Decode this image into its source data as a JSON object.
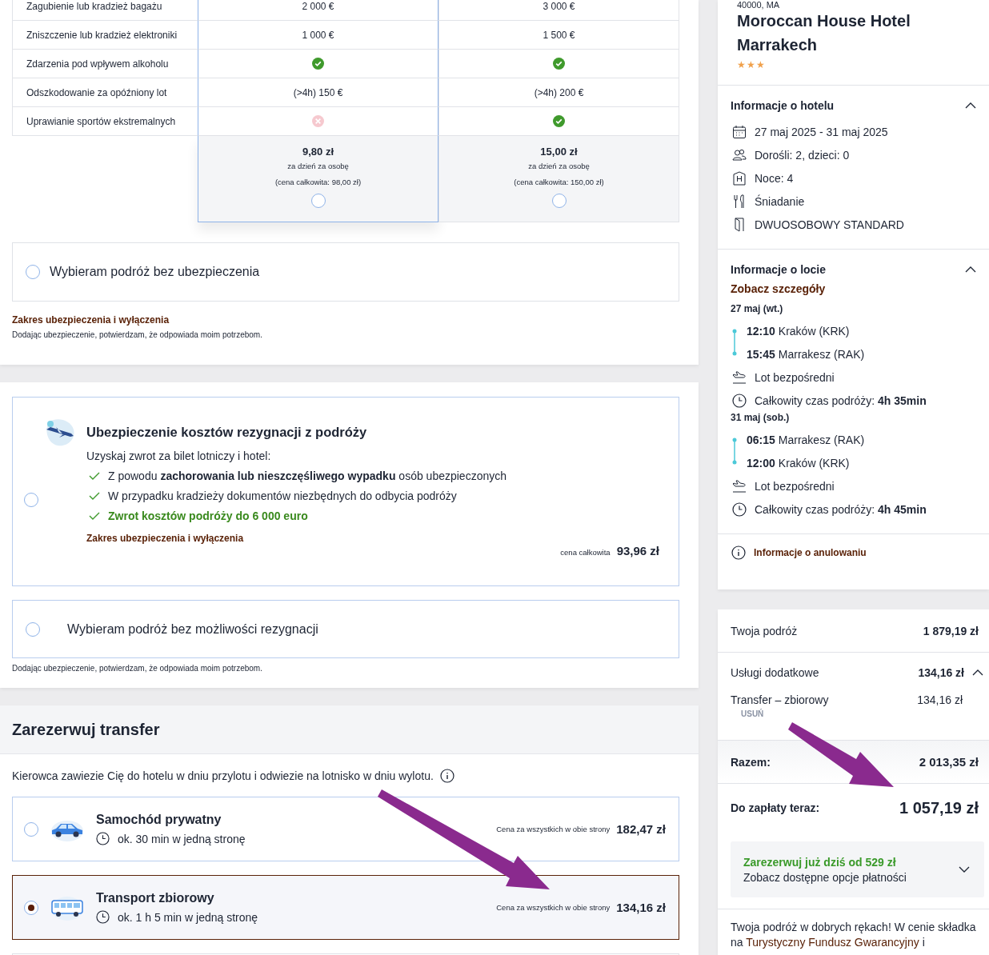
{
  "insurance_table": {
    "rows": [
      {
        "label": "Zagubienie lub kradzież bagażu",
        "cells": [
          {
            "kind": "text",
            "text": "2 000 €"
          },
          {
            "kind": "text",
            "text": "3 000 €"
          }
        ]
      },
      {
        "label": "Zniszczenie lub kradzież elektroniki",
        "cells": [
          {
            "kind": "text",
            "text": "1 000 €"
          },
          {
            "kind": "text",
            "text": "1 500 €"
          }
        ]
      },
      {
        "label": "Zdarzenia pod wpływem alkoholu",
        "cells": [
          {
            "kind": "check"
          },
          {
            "kind": "check"
          }
        ]
      },
      {
        "label": "Odszkodowanie za opóźniony lot",
        "cells": [
          {
            "kind": "text",
            "text": "(>4h) 150 €"
          },
          {
            "kind": "text",
            "text": "(>4h) 200 €"
          }
        ]
      },
      {
        "label": "Uprawianie sportów ekstremalnych",
        "cells": [
          {
            "kind": "cross"
          },
          {
            "kind": "check"
          }
        ]
      }
    ],
    "plans": [
      {
        "price": "9,80 zł",
        "per": "za dzień za osobę",
        "total": "(cena całkowita: 98,00 zł)",
        "highlighted": true,
        "selected": false
      },
      {
        "price": "15,00 zł",
        "per": "za dzień za osobę",
        "total": "(cena całkowita: 150,00 zł)",
        "highlighted": false,
        "selected": false
      }
    ]
  },
  "no_insurance_option": {
    "label": "Wybieram podróż bez ubezpieczenia",
    "selected": false
  },
  "terms_link": "Zakres ubezpieczenia i wyłączenia",
  "consent_note": "Dodając ubezpieczenie, potwierdzam, że odpowiada moim potrzebom.",
  "cancellation": {
    "options": [
      {
        "kind": "offer",
        "title": "Ubezpieczenie kosztów rezygnacji z podróży",
        "intro": "Uzyskaj zwrot za bilet lotniczy i hotel:",
        "features": [
          {
            "text": "Z powodu **zachorowania lub nieszczęśliwego wypadku** osób ubezpieczonych",
            "highlight": false
          },
          {
            "text": "W przypadku kradzieży dokumentów niezbędnych do odbycia podróży",
            "highlight": false
          },
          {
            "text": "Zwrot kosztów podróży do 6 000 euro",
            "highlight": true
          }
        ],
        "link": "Zakres ubezpieczenia i wyłączenia",
        "price_label": "cena całkowita",
        "price": "93,96 zł",
        "selected": false
      },
      {
        "kind": "simple",
        "label": "Wybieram podróż bez możliwości rezygnacji",
        "selected": false
      }
    ],
    "note": "Dodając ubezpieczenie, potwierdzam, że odpowiada moim potrzebom."
  },
  "transfer": {
    "title": "Zarezerwuj transfer",
    "description": "Kierowca zawiezie Cię do hotelu w dniu przylotu i odwiezie na lotnisko w dniu wylotu.",
    "options": [
      {
        "kind": "car",
        "name": "Samochód prywatny",
        "duration": "ok. 30 min w jedną stronę",
        "price_label": "Cena za wszystkich w obie strony",
        "price": "182,47 zł",
        "selected": false
      },
      {
        "kind": "bus",
        "name": "Transport zbiorowy",
        "duration": "ok. 1 h 5 min w jedną stronę",
        "price_label": "Cena za wszystkich w obie strony",
        "price": "134,16 zł",
        "selected": true
      }
    ]
  },
  "hotel": {
    "address": "40000, MA",
    "name": "Moroccan House Hotel Marrakech",
    "stars": 3
  },
  "hotel_info": {
    "title": "Informacje o hotelu",
    "expanded": true,
    "items": [
      {
        "kind": "calendar",
        "text": "27 maj 2025 - 31 maj 2025"
      },
      {
        "kind": "people",
        "text": "Dorośli: 2, dzieci: 0"
      },
      {
        "kind": "hotel",
        "text": "Noce: 4"
      },
      {
        "kind": "meal",
        "text": "Śniadanie"
      },
      {
        "kind": "room",
        "text": "DWUOSOBOWY STANDARD"
      }
    ]
  },
  "flight_info": {
    "title": "Informacje o locie",
    "expanded": true,
    "details_link": "Zobacz szczegóły",
    "legs": [
      {
        "date": "27 maj (wt.)",
        "departure_time": "12:10",
        "departure_place": "Kraków (KRK)",
        "arrival_time": "15:45",
        "arrival_place": "Marrakesz (RAK)",
        "type": "Lot bezpośredni",
        "duration_label": "Całkowity czas podróży:",
        "duration": "4h 35min"
      },
      {
        "date": "31 maj (sob.)",
        "departure_time": "06:15",
        "departure_place": "Marrakesz (RAK)",
        "arrival_time": "12:00",
        "arrival_place": "Kraków (KRK)",
        "type": "Lot bezpośredni",
        "duration_label": "Całkowity czas podróży:",
        "duration": "4h 45min"
      }
    ]
  },
  "cancellation_info_link": "Informacje o anulowaniu",
  "summary": {
    "trip_label": "Twoja podróż",
    "trip_value": "1 879,19 zł",
    "extras_label": "Usługi dodatkowe",
    "extras_value": "134,16 zł",
    "extras_expanded": true,
    "extras": [
      {
        "label": "Transfer – zbiorowy",
        "value": "134,16 zł",
        "remove": "USUŃ"
      }
    ],
    "total_label": "Razem:",
    "total_value": "2 013,35 zł",
    "pay_now_label": "Do zapłaty teraz:",
    "pay_now_value": "1 057,19 zł",
    "payment_promo": {
      "title": "Zarezerwuj już dziś od 529 zł",
      "subtitle": "Zobacz dostępne opcje płatności",
      "expanded": false
    },
    "guarantee_text": "Twoja podróż w dobrych rękach! W cenie składka na **Turystyczny Fundusz Gwarancyjny** i"
  }
}
